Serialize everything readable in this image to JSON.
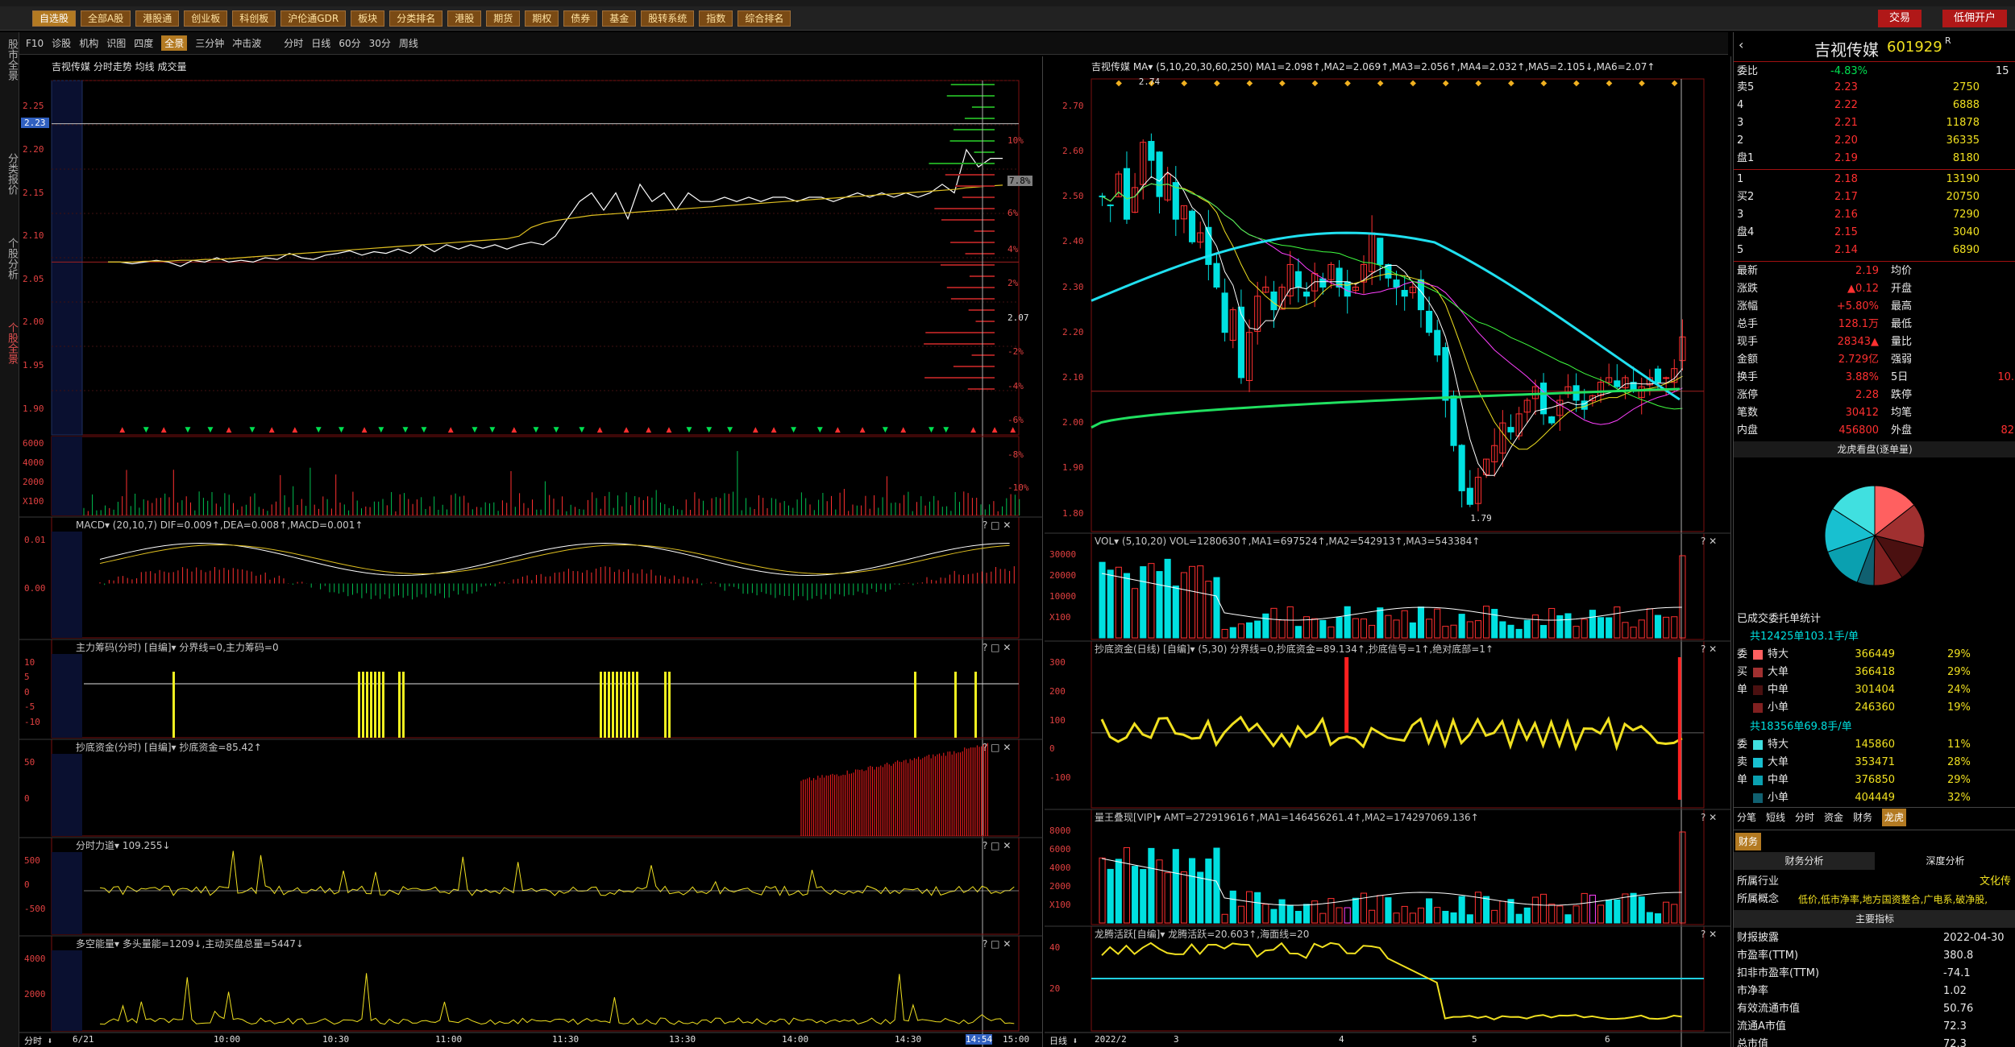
{
  "top_menu": {
    "items": [
      "自选股",
      "全部A股",
      "港股通",
      "创业板",
      "科创板",
      "沪伦通GDR",
      "板块",
      "分类排名",
      "港股",
      "期货",
      "期权",
      "债券",
      "基金",
      "股转系统",
      "指数",
      "综合排名"
    ],
    "selected": 0,
    "trade_btn": "交易",
    "invest_btn": "低佣开户"
  },
  "left_tabs": [
    "股市全景",
    "分类报价",
    "个股分析",
    "个股全景"
  ],
  "toolbar": {
    "left": [
      "F10",
      "诊股",
      "机构",
      "识图",
      "四度",
      "全景",
      "三分钟",
      "冲击波"
    ],
    "right": [
      "分时",
      "日线",
      "60分",
      "30分",
      "周线"
    ],
    "selected": "全景"
  },
  "intraday": {
    "header": "吉视传媒  分时走势  均线  成交量",
    "price_ticks": [
      "2.25",
      "2.20",
      "2.15",
      "2.10",
      "2.05",
      "2.00",
      "1.95",
      "1.90"
    ],
    "pct_ticks": [
      "10%",
      "7.8%",
      "6%",
      "4%",
      "2%",
      "2.07",
      "-2%",
      "-4%",
      "-6%",
      "-8%",
      "-10%"
    ],
    "cursor_label": "2.23",
    "vol_ticks": [
      "6000",
      "4000",
      "2000",
      "X100"
    ],
    "time_ticks": [
      "6/21",
      "10:00",
      "10:30",
      "11:00",
      "11:30",
      "13:30",
      "14:00",
      "14:30",
      "14:54",
      "15:00"
    ],
    "time_btn": "分时",
    "price_path": [
      2.07,
      2.07,
      2.068,
      2.07,
      2.072,
      2.07,
      2.065,
      2.072,
      2.07,
      2.075,
      2.07,
      2.072,
      2.07,
      2.075,
      2.073,
      2.08,
      2.075,
      2.073,
      2.078,
      2.08,
      2.083,
      2.078,
      2.082,
      2.08,
      2.085,
      2.08,
      2.09,
      2.082,
      2.09,
      2.085,
      2.09,
      2.086,
      2.09,
      2.085,
      2.09,
      2.093,
      2.09,
      2.1,
      2.12,
      2.14,
      2.15,
      2.13,
      2.15,
      2.12,
      2.16,
      2.14,
      2.15,
      2.13,
      2.15,
      2.14,
      2.14,
      2.145,
      2.14,
      2.145,
      2.14,
      2.145,
      2.145,
      2.14,
      2.145,
      2.145,
      2.14,
      2.145,
      2.15,
      2.145,
      2.15,
      2.145,
      2.15,
      2.145,
      2.15,
      2.16,
      2.15,
      2.2,
      2.18,
      2.19,
      2.19
    ],
    "avg_path": [
      2.07,
      2.07,
      2.07,
      2.071,
      2.071,
      2.071,
      2.072,
      2.072,
      2.073,
      2.073,
      2.074,
      2.075,
      2.076,
      2.077,
      2.078,
      2.079,
      2.08,
      2.081,
      2.082,
      2.083,
      2.084,
      2.085,
      2.086,
      2.087,
      2.088,
      2.089,
      2.09,
      2.091,
      2.092,
      2.093,
      2.094,
      2.095,
      2.096,
      2.097,
      2.1,
      2.11,
      2.115,
      2.118,
      2.12,
      2.122,
      2.124,
      2.125,
      2.126,
      2.127,
      2.128,
      2.129,
      2.13,
      2.131,
      2.132,
      2.133,
      2.134,
      2.135,
      2.136,
      2.137,
      2.138,
      2.139,
      2.14,
      2.141,
      2.142,
      2.143,
      2.144,
      2.145,
      2.146,
      2.147,
      2.148,
      2.149,
      2.15,
      2.151,
      2.152,
      2.153,
      2.154,
      2.156,
      2.157,
      2.158,
      2.159
    ]
  },
  "sub_panels_left": [
    {
      "name": "MACD",
      "header": "MACD▾ (20,10,7) DIF=0.009↑,DEA=0.008↑,MACD=0.001↑",
      "ticks": [
        "0.01",
        "0.00"
      ]
    },
    {
      "name": "主力筹码",
      "header": "主力筹码(分时) [自编]▾ 分界线=0,主力筹码=0",
      "ticks": [
        "10",
        "5",
        "0",
        "-5",
        "-10"
      ]
    },
    {
      "name": "抄底资金",
      "header": "抄底资金(分时) [自编]▾ 抄底资金=85.42↑",
      "ticks": [
        "50",
        "0"
      ]
    },
    {
      "name": "分时力道",
      "header": "分时力道▾ 109.255↓",
      "ticks": [
        "500",
        "0",
        "-500"
      ]
    },
    {
      "name": "多空能量",
      "header": "多空能量▾ 多头量能=1209↓,主动买盘总量=5447↓",
      "ticks": [
        "4000",
        "2000"
      ]
    }
  ],
  "kline": {
    "header": "吉视传媒  MA▾ (5,10,20,30,60,250)  MA1=2.098↑,MA2=2.069↑,MA3=2.056↑,MA4=2.032↑,MA5=2.105↓,MA6=2.07↑",
    "price_ticks": [
      "2.70",
      "2.60",
      "2.50",
      "2.40",
      "2.30",
      "2.20",
      "2.10",
      "2.00",
      "1.90",
      "1.80"
    ],
    "high_label": "2.74",
    "low_label": "1.79",
    "date_ticks": [
      "2022/2",
      "3",
      "4",
      "5",
      "6"
    ],
    "date_btn": "日线",
    "closes": [
      2.5,
      2.48,
      2.55,
      2.45,
      2.52,
      2.62,
      2.58,
      2.5,
      2.55,
      2.45,
      2.48,
      2.4,
      2.42,
      2.35,
      2.3,
      2.2,
      2.25,
      2.1,
      2.2,
      2.28,
      2.3,
      2.25,
      2.3,
      2.35,
      2.3,
      2.28,
      2.33,
      2.3,
      2.35,
      2.3,
      2.28,
      2.3,
      2.35,
      2.42,
      2.35,
      2.32,
      2.3,
      2.28,
      2.3,
      2.25,
      2.2,
      2.15,
      2.05,
      1.95,
      1.85,
      1.82,
      1.88,
      1.92,
      1.95,
      2.0,
      1.98,
      2.02,
      2.05,
      2.08,
      2.02,
      2.0,
      2.05,
      2.08,
      2.05,
      2.03,
      2.06,
      2.09,
      2.1,
      2.08,
      2.1,
      2.07,
      2.08,
      2.1,
      2.09,
      2.1,
      2.12,
      2.19
    ]
  },
  "sub_panels_right": [
    {
      "name": "VOL",
      "header": "VOL▾ (5,10,20) VOL=1280630↑,MA1=697524↑,MA2=542913↑,MA3=543384↑",
      "ticks": [
        "30000",
        "20000",
        "10000",
        "X100"
      ]
    },
    {
      "name": "抄底资金日线",
      "header": "抄底资金(日线) [自编]▾ (5,30) 分界线=0,抄底资金=89.134↑,抄底信号=1↑,绝对底部=1↑",
      "ticks": [
        "300",
        "200",
        "100",
        "0",
        "-100"
      ]
    },
    {
      "name": "量王叠现",
      "header": "量王叠现[VIP]▾ AMT=272919616↑,MA1=146456261.4↑,MA2=174297069.136↑",
      "ticks": [
        "8000",
        "6000",
        "4000",
        "2000",
        "X100"
      ]
    },
    {
      "name": "龙腾活跃",
      "header": "龙腾活跃[自编]▾ 龙腾活跃=20.603↑,海面线=20",
      "ticks": [
        "40",
        "20"
      ]
    }
  ],
  "quote": {
    "name": "吉视传媒",
    "code": "601929",
    "mark": "R",
    "webi_label": "委比",
    "webi": "-4.83%",
    "webi_vol": "15",
    "sell": [
      [
        "卖5",
        "2.23",
        "2750"
      ],
      [
        "4",
        "2.22",
        "6888"
      ],
      [
        "3",
        "2.21",
        "11878"
      ],
      [
        "2",
        "2.20",
        "36335"
      ],
      [
        "盘1",
        "2.19",
        "8180"
      ]
    ],
    "buy": [
      [
        "1",
        "2.18",
        "13190"
      ],
      [
        "买2",
        "2.17",
        "20750"
      ],
      [
        "3",
        "2.16",
        "7290"
      ],
      [
        "盘4",
        "2.15",
        "3040"
      ],
      [
        "5",
        "2.14",
        "6890"
      ]
    ],
    "stats": [
      [
        "最新",
        "2.19",
        "均价",
        ""
      ],
      [
        "涨跌",
        "▲0.12",
        "开盘",
        ""
      ],
      [
        "涨幅",
        "+5.80%",
        "最高",
        ""
      ],
      [
        "总手",
        "128.1万",
        "最低",
        ""
      ],
      [
        "现手",
        "28343▲",
        "量比",
        ""
      ],
      [
        "金额",
        "2.729亿",
        "强弱",
        ""
      ],
      [
        "换手",
        "3.88%",
        "5日",
        "10."
      ],
      [
        "涨停",
        "2.28",
        "跌停",
        ""
      ],
      [
        "笔数",
        "30412",
        "均笔",
        ""
      ],
      [
        "内盘",
        "456800",
        "外盘",
        "82"
      ]
    ],
    "pie_title": "龙虎看盘(逐单量)",
    "pie": [
      29,
      29,
      24,
      19
    ],
    "order_title": "已成交委托单统计",
    "buy_summary": "共12425单103.1手/单",
    "sell_summary": "共18356单69.8手/单",
    "buy_rows": [
      [
        "委",
        "特大",
        "366449",
        "29%"
      ],
      [
        "买",
        "大单",
        "366418",
        "29%"
      ],
      [
        "单",
        "中单",
        "301404",
        "24%"
      ],
      [
        "",
        "小单",
        "246360",
        "19%"
      ]
    ],
    "sell_rows": [
      [
        "委",
        "特大",
        "145860",
        "11%"
      ],
      [
        "卖",
        "大单",
        "353471",
        "28%"
      ],
      [
        "单",
        "中单",
        "376850",
        "29%"
      ],
      [
        "",
        "小单",
        "404449",
        "32%"
      ]
    ],
    "tabs": [
      "分笔",
      "短线",
      "分时",
      "资金",
      "财务",
      "龙虎"
    ],
    "fin_tab": "财务",
    "fin_sub": [
      "财务分析",
      "深度分析"
    ],
    "industry_label": "所属行业",
    "industry": "文化传",
    "concept_label": "所属概念",
    "concept": "低价,低市净率,地方国资整合,广电系,破净股,",
    "main_idx": "主要指标",
    "fin_rows": [
      [
        "财报披露",
        "2022-04-30"
      ],
      [
        "市盈率(TTM)",
        "380.8"
      ],
      [
        "扣非市盈率(TTM)",
        "-74.1"
      ],
      [
        "市净率",
        "1.02"
      ],
      [
        "有效流通市值",
        "50.76"
      ],
      [
        "流通A市值",
        "72.3"
      ],
      [
        "总市值",
        "72.3"
      ]
    ]
  },
  "colors": {
    "up": "#ff3030",
    "down": "#00e0e0",
    "accent": "#b37a22"
  }
}
